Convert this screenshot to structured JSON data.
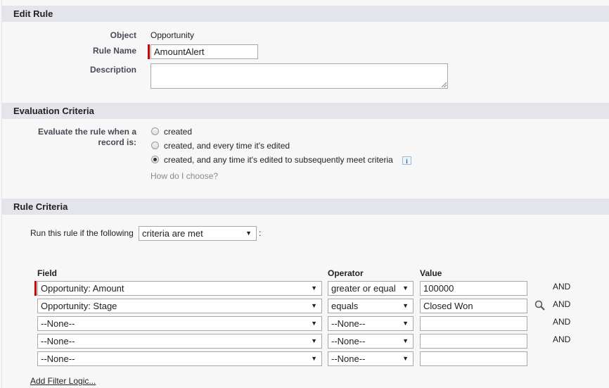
{
  "edit_rule": {
    "header": "Edit Rule",
    "object_label": "Object",
    "object_value": "Opportunity",
    "rule_name_label": "Rule Name",
    "rule_name_value": "AmountAlert",
    "description_label": "Description",
    "description_value": ""
  },
  "evaluation": {
    "header": "Evaluation Criteria",
    "label_line1": "Evaluate the rule when a",
    "label_line2": "record is:",
    "options": [
      {
        "label": "created",
        "selected": false
      },
      {
        "label": "created, and every time it's edited",
        "selected": false
      },
      {
        "label": "created, and any time it's edited to subsequently meet criteria",
        "selected": true
      }
    ],
    "info_icon": "info-icon",
    "help_link": "How do I choose?"
  },
  "rule_criteria": {
    "header": "Rule Criteria",
    "run_prefix": "Run this rule if the following",
    "run_select": "criteria are met",
    "run_suffix": ":",
    "columns": {
      "field": "Field",
      "operator": "Operator",
      "value": "Value"
    },
    "rows": [
      {
        "field": "Opportunity: Amount",
        "operator": "greater or equal",
        "value": "100000",
        "conj": "AND",
        "required": true,
        "lookup": false
      },
      {
        "field": "Opportunity: Stage",
        "operator": "equals",
        "value": "Closed Won",
        "conj": "AND",
        "required": false,
        "lookup": true
      },
      {
        "field": "--None--",
        "operator": "--None--",
        "value": "",
        "conj": "AND",
        "required": false,
        "lookup": false
      },
      {
        "field": "--None--",
        "operator": "--None--",
        "value": "",
        "conj": "AND",
        "required": false,
        "lookup": false
      },
      {
        "field": "--None--",
        "operator": "--None--",
        "value": "",
        "conj": "",
        "required": false,
        "lookup": false
      }
    ],
    "add_filter_logic": "Add Filter Logic..."
  },
  "icons": {
    "dropdown": "chevron-down-icon",
    "lookup": "lookup-magnifier-icon"
  },
  "colors": {
    "required": "#cc0000",
    "section_header_bg": "#e3e5ea"
  }
}
